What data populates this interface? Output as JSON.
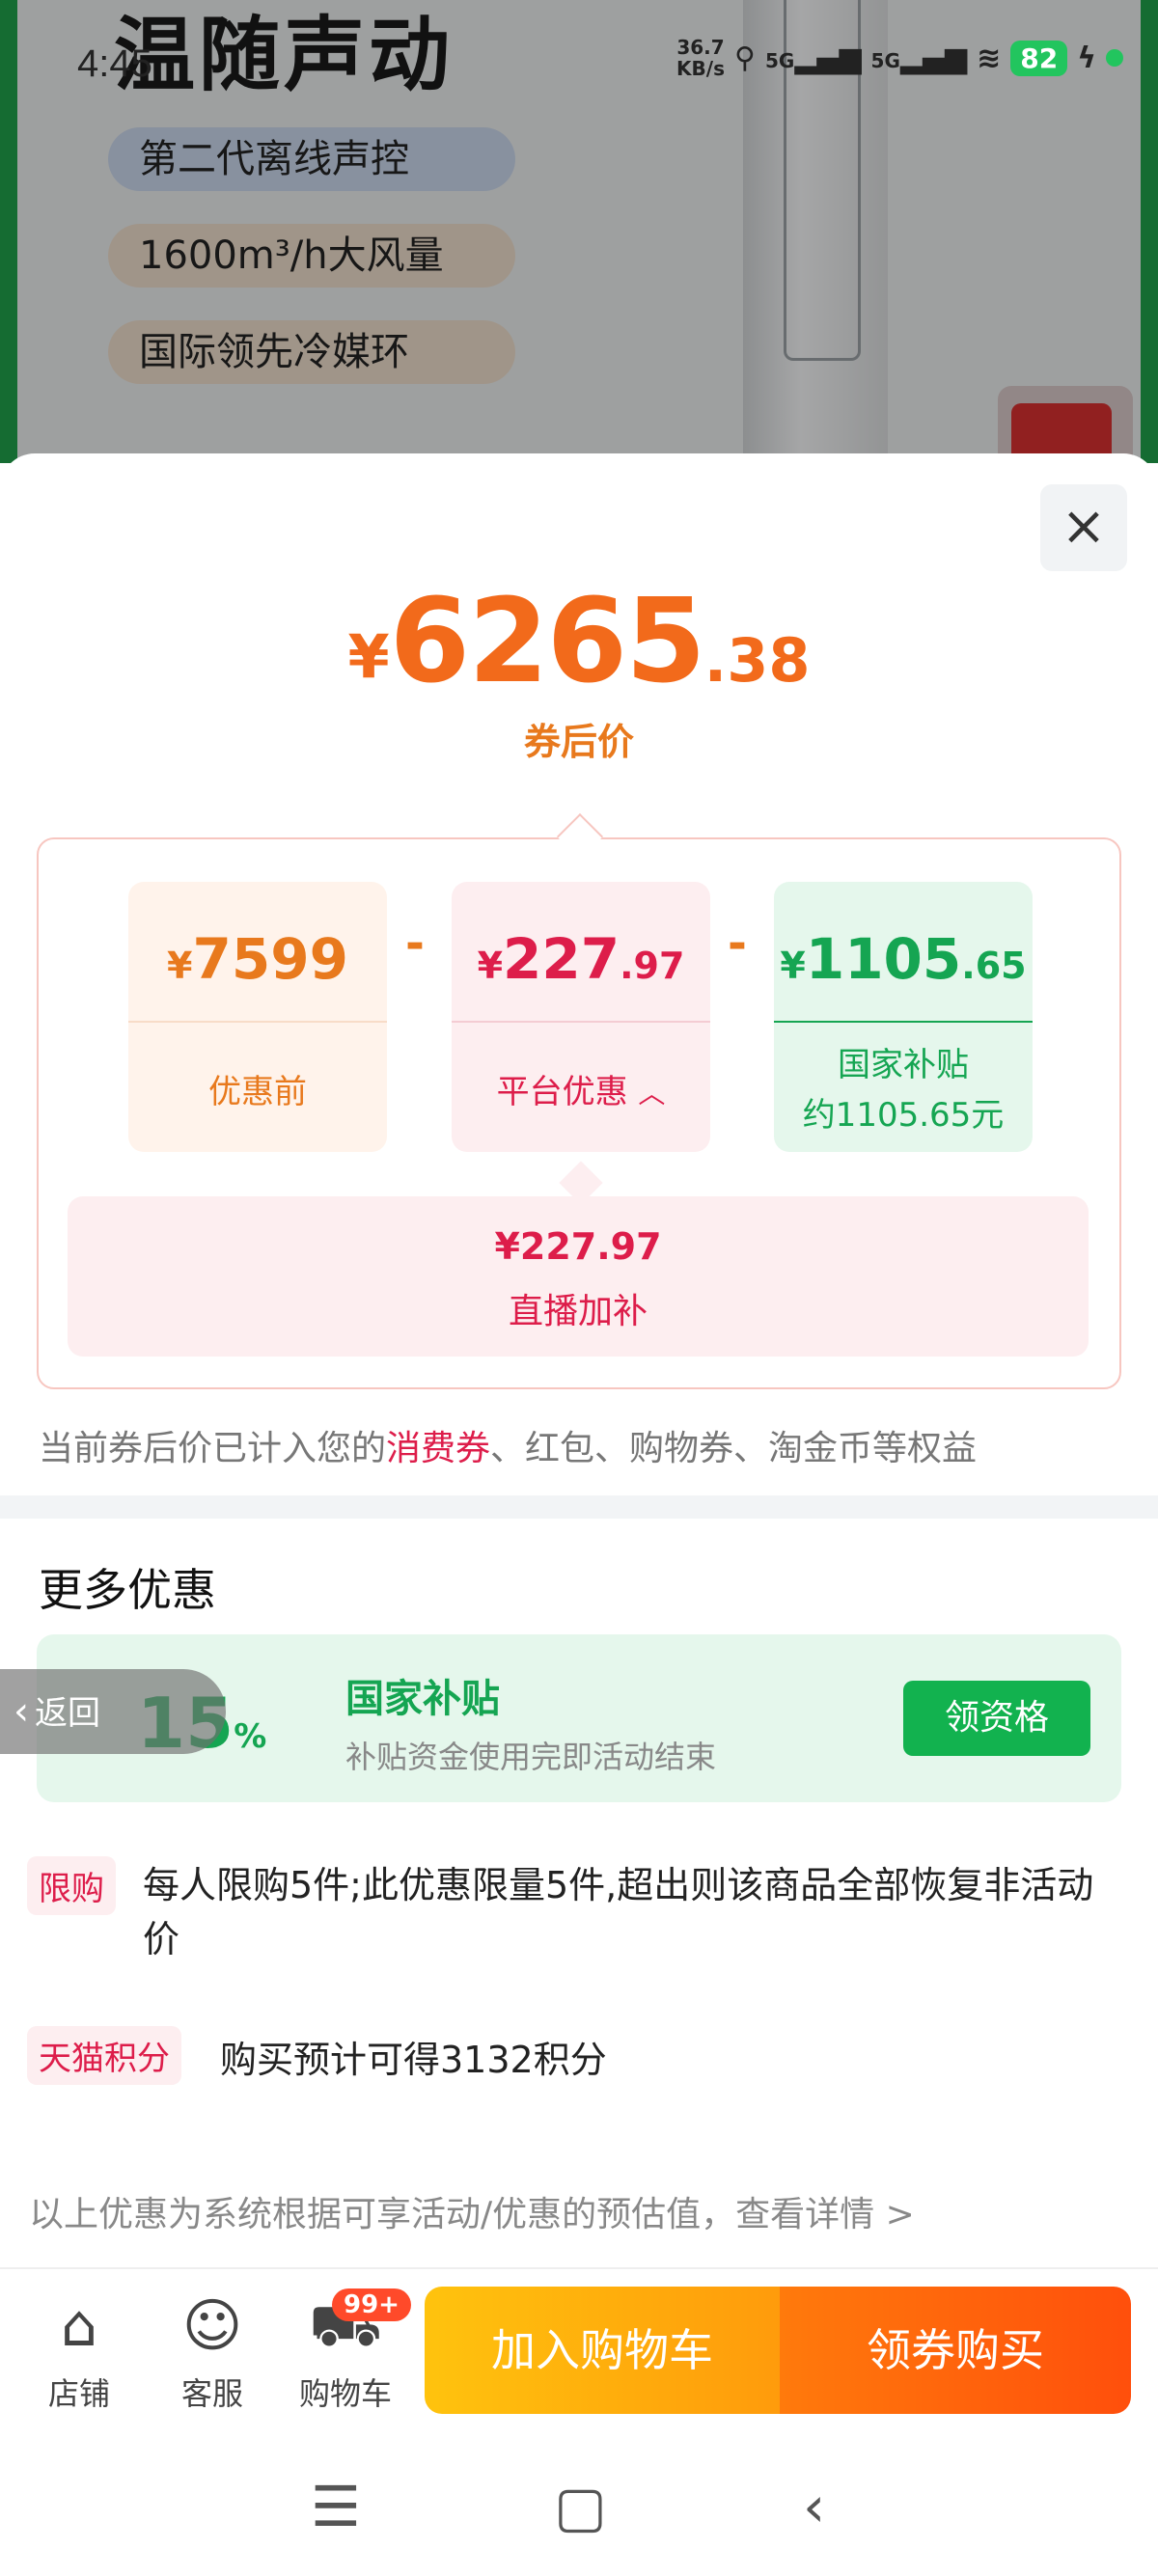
{
  "background": {
    "title": "温随声动",
    "features": [
      "第二代离线声控",
      "1600m³/h大风量",
      "国际领先冷媒环"
    ]
  },
  "status_bar": {
    "time": "4:45",
    "speed_value": "36.7",
    "speed_unit": "KB/s",
    "signal1": "5G",
    "signal2": "5G",
    "battery": "82"
  },
  "price": {
    "currency": "¥",
    "integer": "6265",
    "decimal": ".38",
    "label": "券后价"
  },
  "breakdown": {
    "original": {
      "currency": "¥",
      "integer": "7599",
      "decimal": "",
      "label": "优惠前"
    },
    "minus": "-",
    "platform": {
      "currency": "¥",
      "integer": "227",
      "decimal": ".97",
      "label": "平台优惠"
    },
    "subsidy": {
      "currency": "¥",
      "integer": "1105",
      "decimal": ".65",
      "label_line1": "国家补贴",
      "label_line2": "约1105.65元"
    },
    "live": {
      "value": "¥227.97",
      "label": "直播加补"
    }
  },
  "note": {
    "prefix": "当前券后价已计入您的",
    "highlight": "消费券",
    "suffix": "、红包、购物券、淘金币等权益"
  },
  "more": {
    "title": "更多优惠",
    "subsidy_card": {
      "percent": "15",
      "percent_sign": "%",
      "title": "国家补贴",
      "desc": "补贴资金使用完即活动结束",
      "button": "领资格"
    },
    "back_label": "返回",
    "limit_tag": "限购",
    "limit_text": "每人限购5件;此优惠限量5件,超出则该商品全部恢复非活动价",
    "points_tag": "天猫积分",
    "points_text": "购买预计可得3132积分",
    "footnote": "以上优惠为系统根据可享活动/优惠的预估值，查看详情 >"
  },
  "bottom_bar": {
    "store": "店铺",
    "service": "客服",
    "cart": "购物车",
    "cart_badge": "99+",
    "add_cart": "加入购物车",
    "buy": "领券购买"
  },
  "colors": {
    "accent_orange": "#f26a1b",
    "accent_red": "#dd1d4a",
    "accent_green": "#15a552"
  }
}
